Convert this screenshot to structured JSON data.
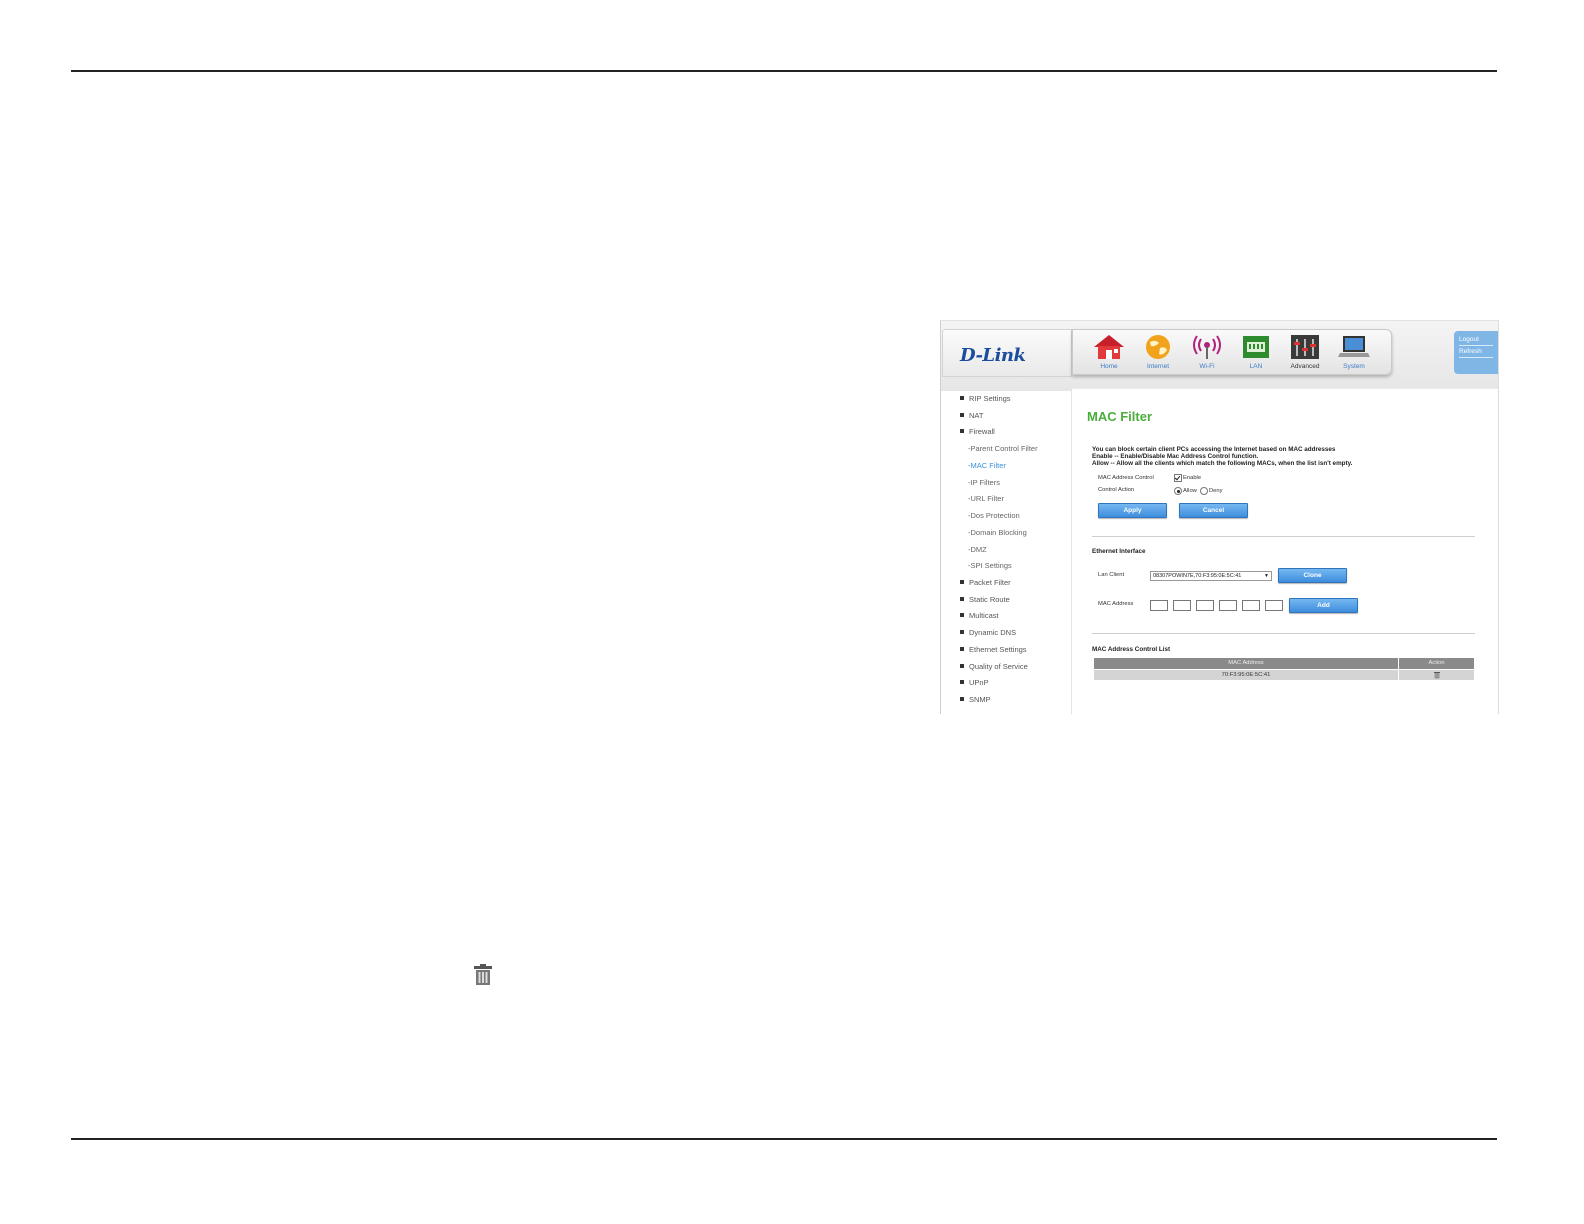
{
  "nav": {
    "logo": "D-Link",
    "items": [
      {
        "label": "Home"
      },
      {
        "label": "Internet"
      },
      {
        "label": "Wi-Fi"
      },
      {
        "label": "LAN"
      },
      {
        "label": "Advanced"
      },
      {
        "label": "System"
      }
    ],
    "logout": "Logout",
    "refresh": "Refresh"
  },
  "sidebar": {
    "items": [
      "RIP Settings",
      "NAT",
      "Firewall",
      "-Parent Control Filter",
      "-MAC Filter",
      "-IP Filters",
      "-URL Filter",
      "-Dos Protection",
      "-Domain Blocking",
      "-DMZ",
      "-SPI Settings",
      "Packet Filter",
      "Static Route",
      "Multicast",
      "Dynamic DNS",
      "Ethernet Settings",
      "Quality of Service",
      "UPnP",
      "SNMP"
    ],
    "active": "-MAC Filter"
  },
  "main": {
    "title": "MAC Filter",
    "desc1": "You can block certain client PCs accessing the Internet based on MAC addresses",
    "desc2": "Enable -- Enable/Disable Mac Address Control function.",
    "desc3": "Allow -- Allow all the clients which match the following MACs, when the list isn't empty.",
    "mac_control_label": "MAC Address Control",
    "enable_label": "Enable",
    "enable_checked": true,
    "control_action_label": "Control Action",
    "allow_label": "Allow",
    "deny_label": "Deny",
    "selected_action": "Allow",
    "apply_label": "Apply",
    "cancel_label": "Cancel",
    "ethernet_section": "Ethernet Interface",
    "lan_client_label": "Lan Client",
    "lan_client_value": "08307POWIN7E,70:F3:95:0E:5C:41",
    "clone_label": "Clone",
    "mac_address_label": "MAC Address",
    "add_label": "Add",
    "list_section": "MAC Address Control List",
    "table": {
      "headers": [
        "MAC Address",
        "Action"
      ],
      "rows": [
        [
          "70:F3:95:0E:5C:41"
        ]
      ]
    }
  },
  "icons": {
    "trash": "trash-icon"
  }
}
